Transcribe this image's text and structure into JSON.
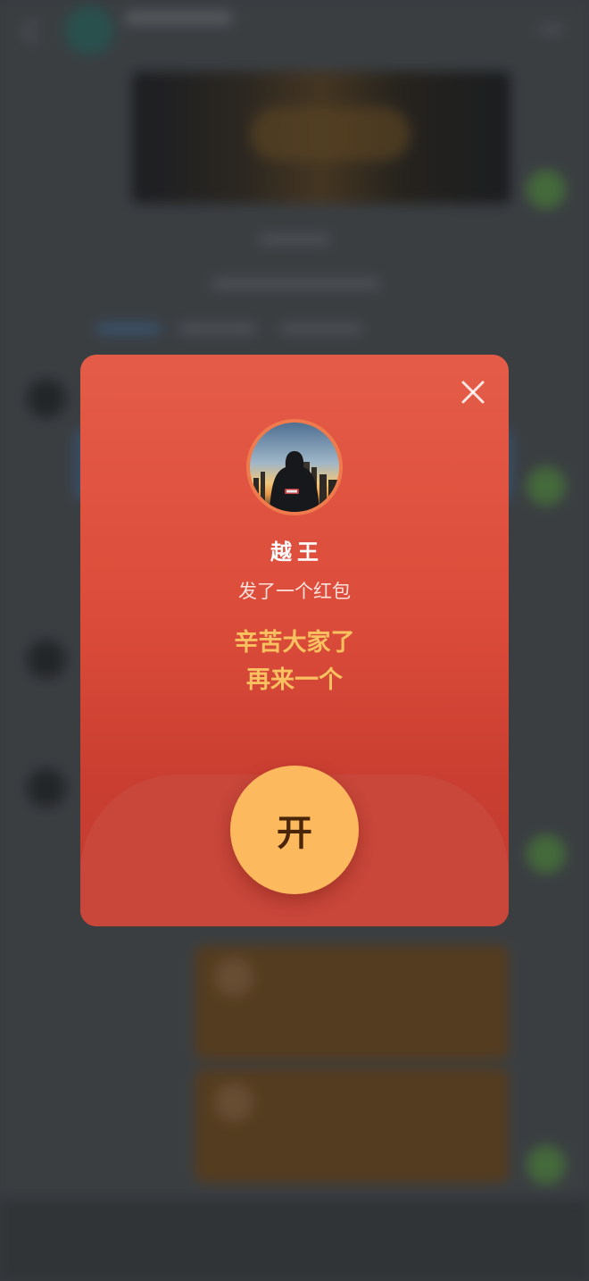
{
  "red_packet": {
    "close_icon": "close-icon",
    "sender_name": "越王",
    "sent_text": "发了一个红包",
    "blessing_line1": "辛苦大家了",
    "blessing_line2": "再来一个",
    "open_label": "开",
    "colors": {
      "packet_top": "#e45c48",
      "packet_bottom": "#c33b30",
      "blessing_text": "#f9c160",
      "open_button": "#fdb95e",
      "open_text": "#4a2608"
    }
  }
}
